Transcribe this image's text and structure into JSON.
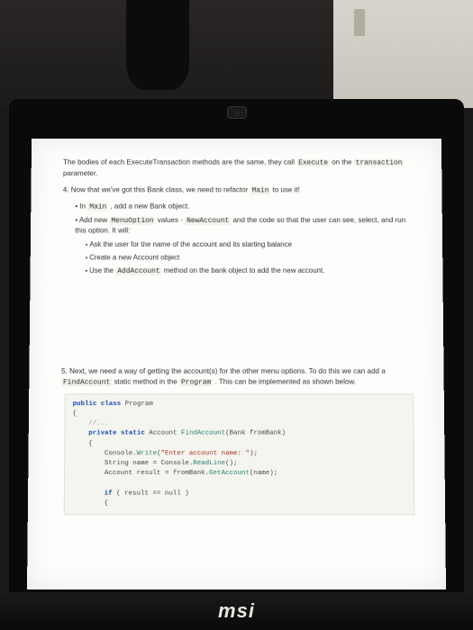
{
  "laptop": {
    "brand": "msi"
  },
  "doc": {
    "intro_a": "The bodies of each ExecuteTransaction methods are the same, they call ",
    "intro_code1": "Execute",
    "intro_b": " on the ",
    "intro_code2": "transaction",
    "intro_c": " parameter.",
    "step4_a": "4. Now that we've got this Bank class, we need to refactor ",
    "step4_code": "Main",
    "step4_b": " to use it!",
    "s4_li1_a": "In ",
    "s4_li1_code": "Main",
    "s4_li1_b": " , add a new Bank object.",
    "s4_li2_a": "Add new ",
    "s4_li2_code1": "MenuOption",
    "s4_li2_b": " values - ",
    "s4_li2_code2": "NewAccount",
    "s4_li2_c": " and the code so that the user can see, select, and run this option. It will:",
    "s4_sub1": "Ask the user for the name of the account and its starting balance",
    "s4_sub2": "Create a new Account object",
    "s4_sub3_a": "Use the ",
    "s4_sub3_code": "AddAccount",
    "s4_sub3_b": " method on the bank object to add the new account.",
    "step5_a": "5. Next, we need a way of getting the account(s) for the other menu options. To do this we can add a ",
    "step5_code1": "FindAccount",
    "step5_b": " static method in the ",
    "step5_code2": "Program",
    "step5_c": " . This can be implemented as shown below.",
    "code": {
      "l1_kw1": "public class",
      "l1_rest": " Program",
      "l2": "{",
      "l3": "    //...",
      "l4_kw1": "    private static",
      "l4_mid": " Account ",
      "l4_fn": "FindAccount",
      "l4_rest": "(Bank fromBank)",
      "l5": "    {",
      "l6_a": "        Console.",
      "l6_fn": "Write",
      "l6_b": "(",
      "l6_str": "\"Enter account name: \"",
      "l6_c": ");",
      "l7_a": "        String name = Console.",
      "l7_fn": "ReadLine",
      "l7_b": "();",
      "l8_a": "        Account result = fromBank.",
      "l8_fn": "GetAccount",
      "l8_b": "(name);",
      "l9": " ",
      "l10_kw": "        if",
      "l10_rest": " ( result == null )",
      "l11": "        {"
    }
  }
}
